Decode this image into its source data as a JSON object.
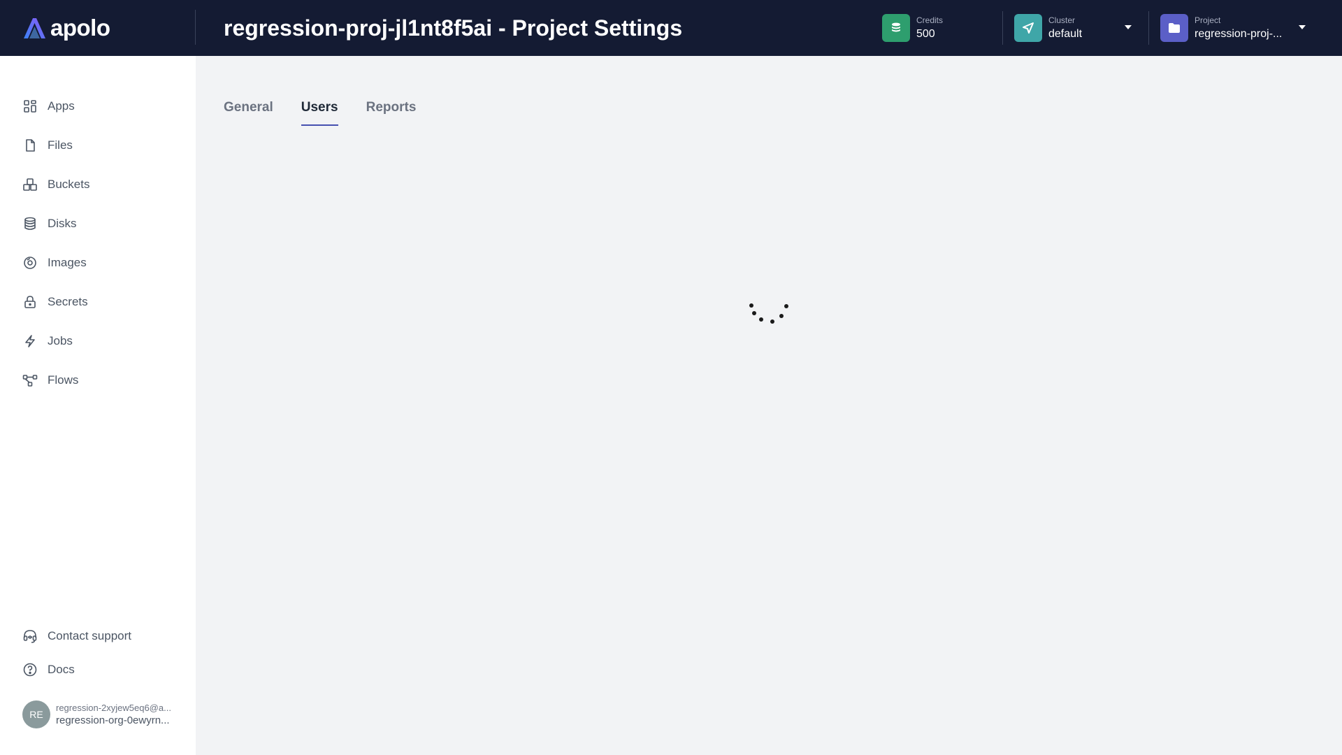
{
  "brand": {
    "name": "apolo"
  },
  "header": {
    "title": "regression-proj-jl1nt8f5ai - Project Settings",
    "credits": {
      "label": "Credits",
      "value": "500",
      "icon": "coins-icon",
      "color": "#2e9e6e"
    },
    "cluster": {
      "label": "Cluster",
      "value": "default",
      "icon": "send-icon",
      "color": "#3fa6a8"
    },
    "project": {
      "label": "Project",
      "value": "regression-proj-...",
      "icon": "folder-icon",
      "color": "#5b5fc7"
    }
  },
  "sidebar": {
    "items": [
      {
        "label": "Apps",
        "icon": "apps-grid-icon"
      },
      {
        "label": "Files",
        "icon": "file-icon"
      },
      {
        "label": "Buckets",
        "icon": "buckets-icon"
      },
      {
        "label": "Disks",
        "icon": "database-icon"
      },
      {
        "label": "Images",
        "icon": "image-disc-icon"
      },
      {
        "label": "Secrets",
        "icon": "lock-icon"
      },
      {
        "label": "Jobs",
        "icon": "lightning-icon"
      },
      {
        "label": "Flows",
        "icon": "flow-icon"
      }
    ],
    "footer_items": [
      {
        "label": "Contact support",
        "icon": "headset-icon"
      },
      {
        "label": "Docs",
        "icon": "help-circle-icon"
      }
    ],
    "user": {
      "initials": "RE",
      "email": "regression-2xyjew5eq6@a...",
      "org": "regression-org-0ewyrn..."
    }
  },
  "tabs": [
    {
      "label": "General",
      "active": false
    },
    {
      "label": "Users",
      "active": true
    },
    {
      "label": "Reports",
      "active": false
    }
  ],
  "accent_color": "#4650b0"
}
